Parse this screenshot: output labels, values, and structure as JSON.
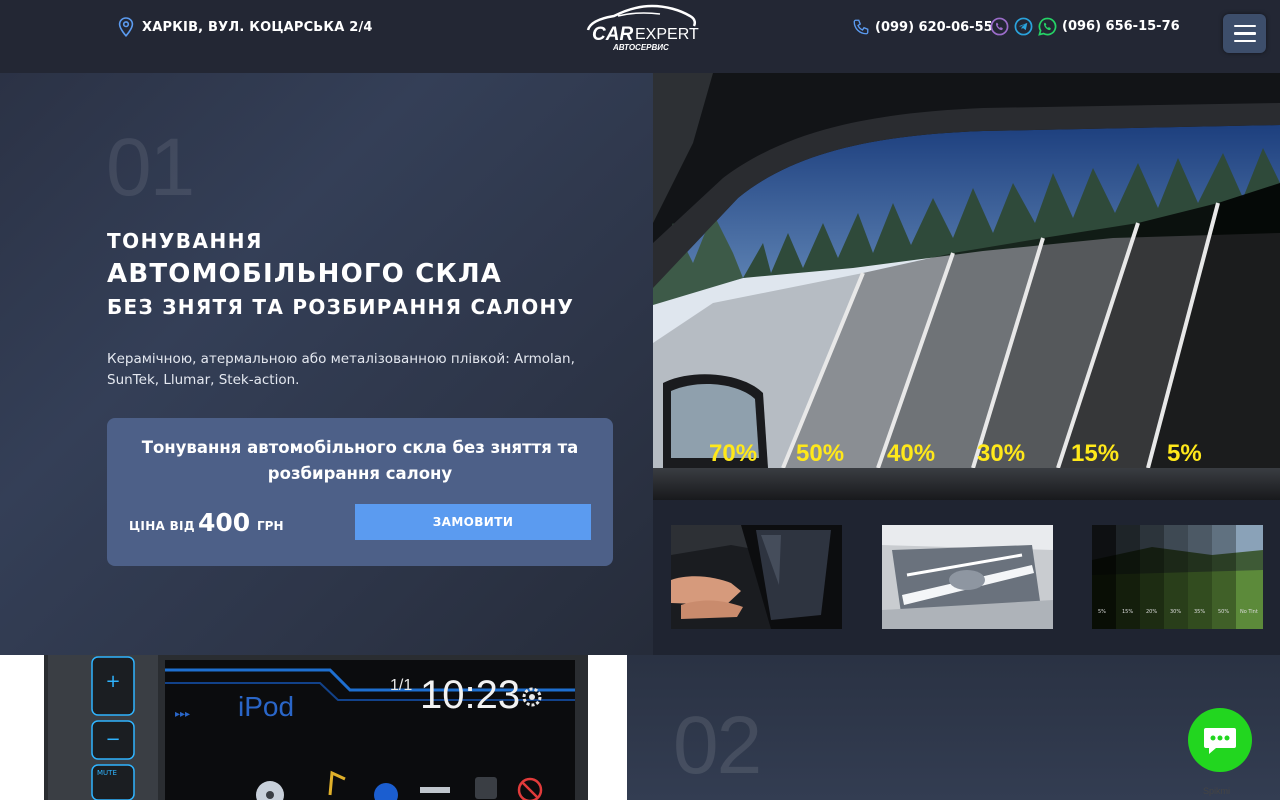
{
  "header": {
    "address": "ХАРКІВ, ВУЛ. КОЦАРСЬКА 2/4",
    "logo": {
      "main": "CAR",
      "secondary": "EXPERT",
      "sub": "АВТОСЕРВИС"
    },
    "phone1": "(099) 620-06-55",
    "phone2": "(096) 656-15-76",
    "colors": {
      "viber": "#7f4da0",
      "telegram": "#2aa3dc",
      "whatsapp": "#25d366",
      "menu": "#3d4e6b"
    }
  },
  "hero": {
    "number": "01",
    "title_line1": "ТОНУВАННЯ",
    "title_line2": "АВТОМОБІЛЬНОГО СКЛА",
    "title_line3": "БЕЗ ЗНЯТЯ ТА РОЗБИРАННЯ САЛОНУ",
    "description": "Керамічною, атермальною або металізованною плівкой: Armolan, SunTek, Llumar, Stek-action.",
    "card": {
      "title": "Тонування автомобільного скла без зняття та розбирання салону",
      "price_label": "ЦІНА ВІД",
      "price_value": "400",
      "price_currency": "ГРН",
      "order_button": "ЗАМОВИТИ"
    },
    "tint_levels": [
      "70%",
      "50%",
      "40%",
      "30%",
      "15%",
      "5%"
    ],
    "thumb3_levels": [
      "5%",
      "15%",
      "20%",
      "30%",
      "35%",
      "50%",
      "No Tint"
    ]
  },
  "section2": {
    "number": "02",
    "radio": {
      "track": "1/1",
      "time": "10:23",
      "source": "iPod",
      "mute": "MUTE"
    }
  },
  "chat": {
    "label": "Spikmi",
    "color": "#22d61f"
  }
}
